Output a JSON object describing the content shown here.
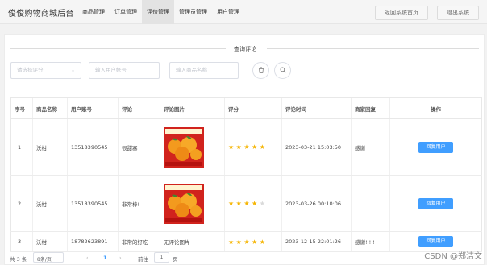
{
  "header": {
    "brand": "俊俊购物商城后台",
    "nav": [
      "商品管理",
      "订单管理",
      "评价管理",
      "管理员管理",
      "用户管理"
    ],
    "active_nav": "评价管理",
    "home_button": "返回系统首页",
    "logout_button": "退出系统"
  },
  "filter": {
    "title": "查询评论",
    "rating_placeholder": "请选择评分",
    "account_placeholder": "输入用户帐号",
    "product_placeholder": "输入商品名称"
  },
  "table": {
    "columns": [
      "序号",
      "商品名称",
      "用户账号",
      "评论",
      "评论图片",
      "评分",
      "评论时间",
      "商家回复",
      "操作"
    ],
    "rows": [
      {
        "index": "1",
        "product": "沃柑",
        "account": "13518390545",
        "comment": "很甜塞",
        "image": "orange-photo",
        "image_text": "",
        "rating": 5,
        "time": "2023-03-21 15:03:50",
        "reply": "感谢",
        "action": "回复用户"
      },
      {
        "index": "2",
        "product": "沃柑",
        "account": "13518390545",
        "comment": "非常棒!",
        "image": "orange-photo",
        "image_text": "",
        "rating": 4,
        "time": "2023-03-26 00:10:06",
        "reply": "",
        "action": "回复用户"
      },
      {
        "index": "3",
        "product": "沃柑",
        "account": "18782623891",
        "comment": "非常的好吃",
        "image": "",
        "image_text": "无评论图片",
        "rating": 5,
        "time": "2023-12-15 22:01:26",
        "reply": "感谢! ! !",
        "action": "回复用户"
      }
    ]
  },
  "pagination": {
    "total": "共 3 条",
    "page_size": "8条/页",
    "prev": "‹",
    "current": "1",
    "next": "›",
    "goto_label": "前往",
    "goto_value": "1",
    "page_suffix": "页"
  },
  "watermark": "CSDN @郑洁文"
}
